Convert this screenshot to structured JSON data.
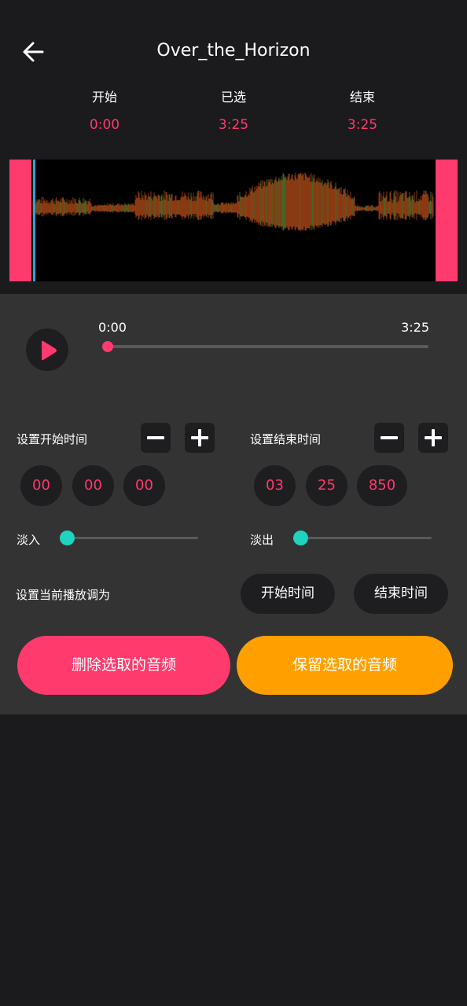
{
  "colors": {
    "accent_pink": "#ff3a6d",
    "accent_orange": "#ffa000",
    "accent_teal": "#1ed4bf",
    "playhead_blue": "#27a4e0",
    "waveform": "#8a3a12"
  },
  "header": {
    "back_icon": "arrow-left-icon",
    "title": "Over_the_Horizon"
  },
  "summary": {
    "start_label": "开始",
    "start_value": "0:00",
    "selected_label": "已选",
    "selected_value": "3:25",
    "end_label": "结束",
    "end_value": "3:25"
  },
  "player": {
    "play_icon": "play-icon",
    "position_start": "0:00",
    "position_end": "3:25",
    "progress": 0
  },
  "start_time": {
    "label": "设置开始时间",
    "minutes": "00",
    "seconds": "00",
    "millis": "00"
  },
  "end_time": {
    "label": "设置结束时间",
    "minutes": "03",
    "seconds": "25",
    "millis": "850"
  },
  "fade": {
    "in_label": "淡入",
    "in_value": 0,
    "out_label": "淡出",
    "out_value": 0
  },
  "set_current": {
    "label": "设置当前播放调为",
    "start_button": "开始时间",
    "end_button": "结束时间"
  },
  "actions": {
    "delete_button": "删除选取的音频",
    "keep_button": "保留选取的音频"
  }
}
